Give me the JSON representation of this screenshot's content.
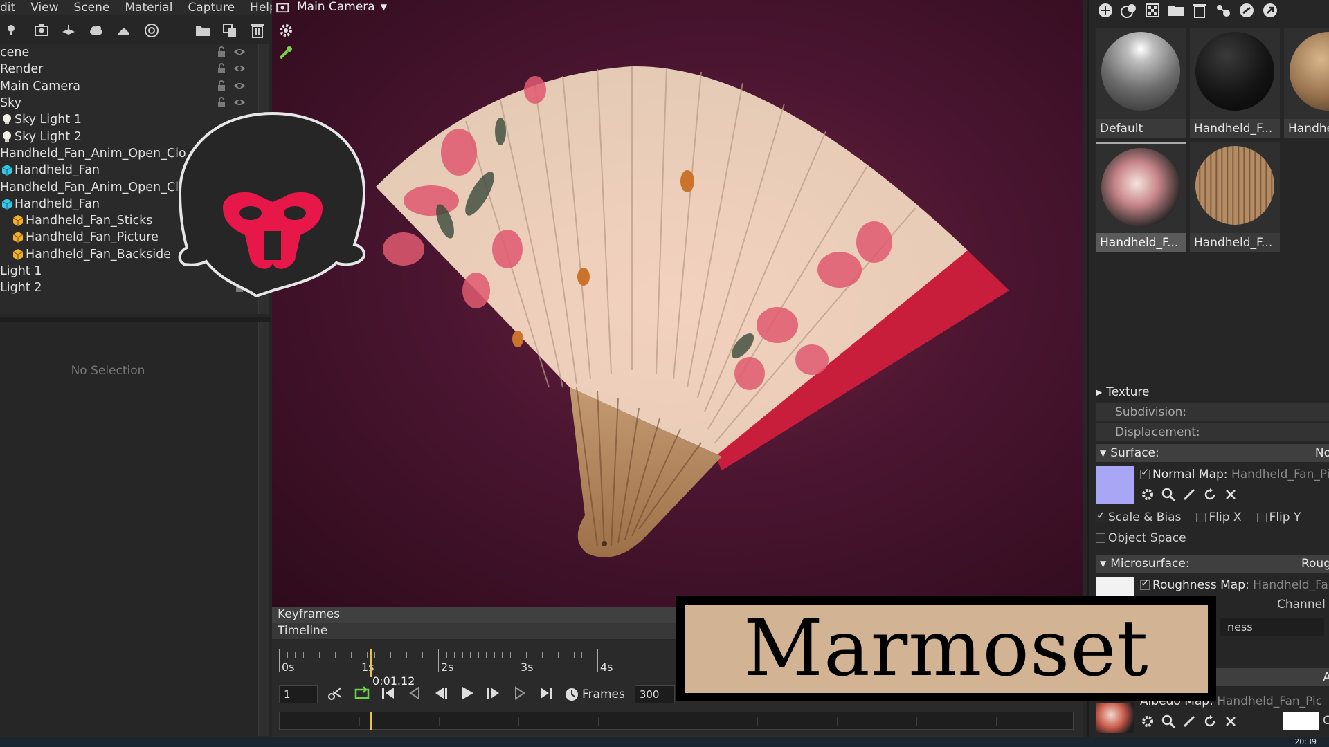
{
  "menu": [
    "dit",
    "View",
    "Scene",
    "Material",
    "Capture",
    "Help"
  ],
  "scene_tree": [
    {
      "label": "cene",
      "indent": 0,
      "icon": "none",
      "locked": true,
      "visible": true
    },
    {
      "label": "Render",
      "indent": 0,
      "icon": "none",
      "locked": true,
      "visible": true
    },
    {
      "label": "Main Camera",
      "indent": 0,
      "icon": "none",
      "locked": true,
      "visible": true
    },
    {
      "label": "Sky",
      "indent": 0,
      "icon": "none",
      "locked": true,
      "visible": true
    },
    {
      "label": "Sky Light 1",
      "indent": 1,
      "icon": "light-bulb-icon",
      "locked": false,
      "visible": false
    },
    {
      "label": "Sky Light 2",
      "indent": 1,
      "icon": "light-bulb-icon",
      "locked": false,
      "visible": false
    },
    {
      "label": "Handheld_Fan_Anim_Open_Clo",
      "indent": 0,
      "icon": "none",
      "locked": false,
      "visible": false
    },
    {
      "label": "Handheld_Fan",
      "indent": 1,
      "icon": "mesh-cyan-icon",
      "locked": false,
      "visible": false
    },
    {
      "label": "Handheld_Fan_Anim_Open_Cl",
      "indent": 0,
      "icon": "none",
      "locked": false,
      "visible": false
    },
    {
      "label": "Handheld_Fan",
      "indent": 1,
      "icon": "mesh-cyan-icon",
      "locked": false,
      "visible": false
    },
    {
      "label": "Handheld_Fan_Sticks",
      "indent": 2,
      "icon": "mesh-orange-icon",
      "locked": false,
      "visible": false
    },
    {
      "label": "Handheld_Fan_Picture",
      "indent": 2,
      "icon": "mesh-orange-icon",
      "locked": false,
      "visible": false
    },
    {
      "label": "Handheld_Fan_Backside",
      "indent": 2,
      "icon": "mesh-orange-icon",
      "locked": false,
      "visible": false
    },
    {
      "label": "Light 1",
      "indent": 0,
      "icon": "none",
      "locked": false,
      "visible": false
    },
    {
      "label": "Light 2",
      "indent": 0,
      "icon": "none",
      "locked": true,
      "visible": false
    }
  ],
  "properties": {
    "no_selection": "No Selection"
  },
  "viewport": {
    "camera_label": "Main Camera"
  },
  "timeline": {
    "keyframes_label": "Keyframes",
    "timeline_label": "Timeline",
    "ruler_labels": [
      "0s",
      "1s",
      "2s",
      "3s",
      "4s"
    ],
    "playhead_label": "0:01.12",
    "playhead_seconds": 1.4,
    "current_frame": "1",
    "frames_label": "Frames",
    "frames_value": "300"
  },
  "materials": [
    {
      "label": "Default",
      "style": "default"
    },
    {
      "label": "Handheld_F...",
      "style": "dark"
    },
    {
      "label": "Handhe",
      "style": "wood"
    },
    {
      "label": "Handheld_F...",
      "style": "picture",
      "selected": true
    },
    {
      "label": "Handheld_F...",
      "style": "sticks"
    }
  ],
  "material_props": {
    "texture": "Texture",
    "subdivision": "Subdivision:",
    "displacement": "Displacement:",
    "surface": "Surface:",
    "surface_right": "No",
    "normal_map_label": "Normal Map:",
    "normal_map_value": "Handheld_Fan_Pic",
    "scale_bias": "Scale & Bias",
    "flip_x": "Flip X",
    "flip_y": "Flip Y",
    "object_space": "Object Space",
    "microsurface": "Microsurface:",
    "microsurface_right": "Roug",
    "roughness_map_label": "Roughness Map:",
    "roughness_map_value": "Handheld_Fan",
    "channel": "Channel",
    "gloss_partial": "ness",
    "albedo_right": "A",
    "albedo_map_label": "Albedo Map:",
    "albedo_map_value": "Handheld_Fan_Pic",
    "albedo_extra": "C"
  },
  "overlay": {
    "brand_title": "Marmoset"
  },
  "taskbar": {
    "clock": "20:39"
  },
  "colors": {
    "accent": "#e8c24a",
    "mascot_red": "#e8174a",
    "viewport_bg": "#4a1530"
  }
}
